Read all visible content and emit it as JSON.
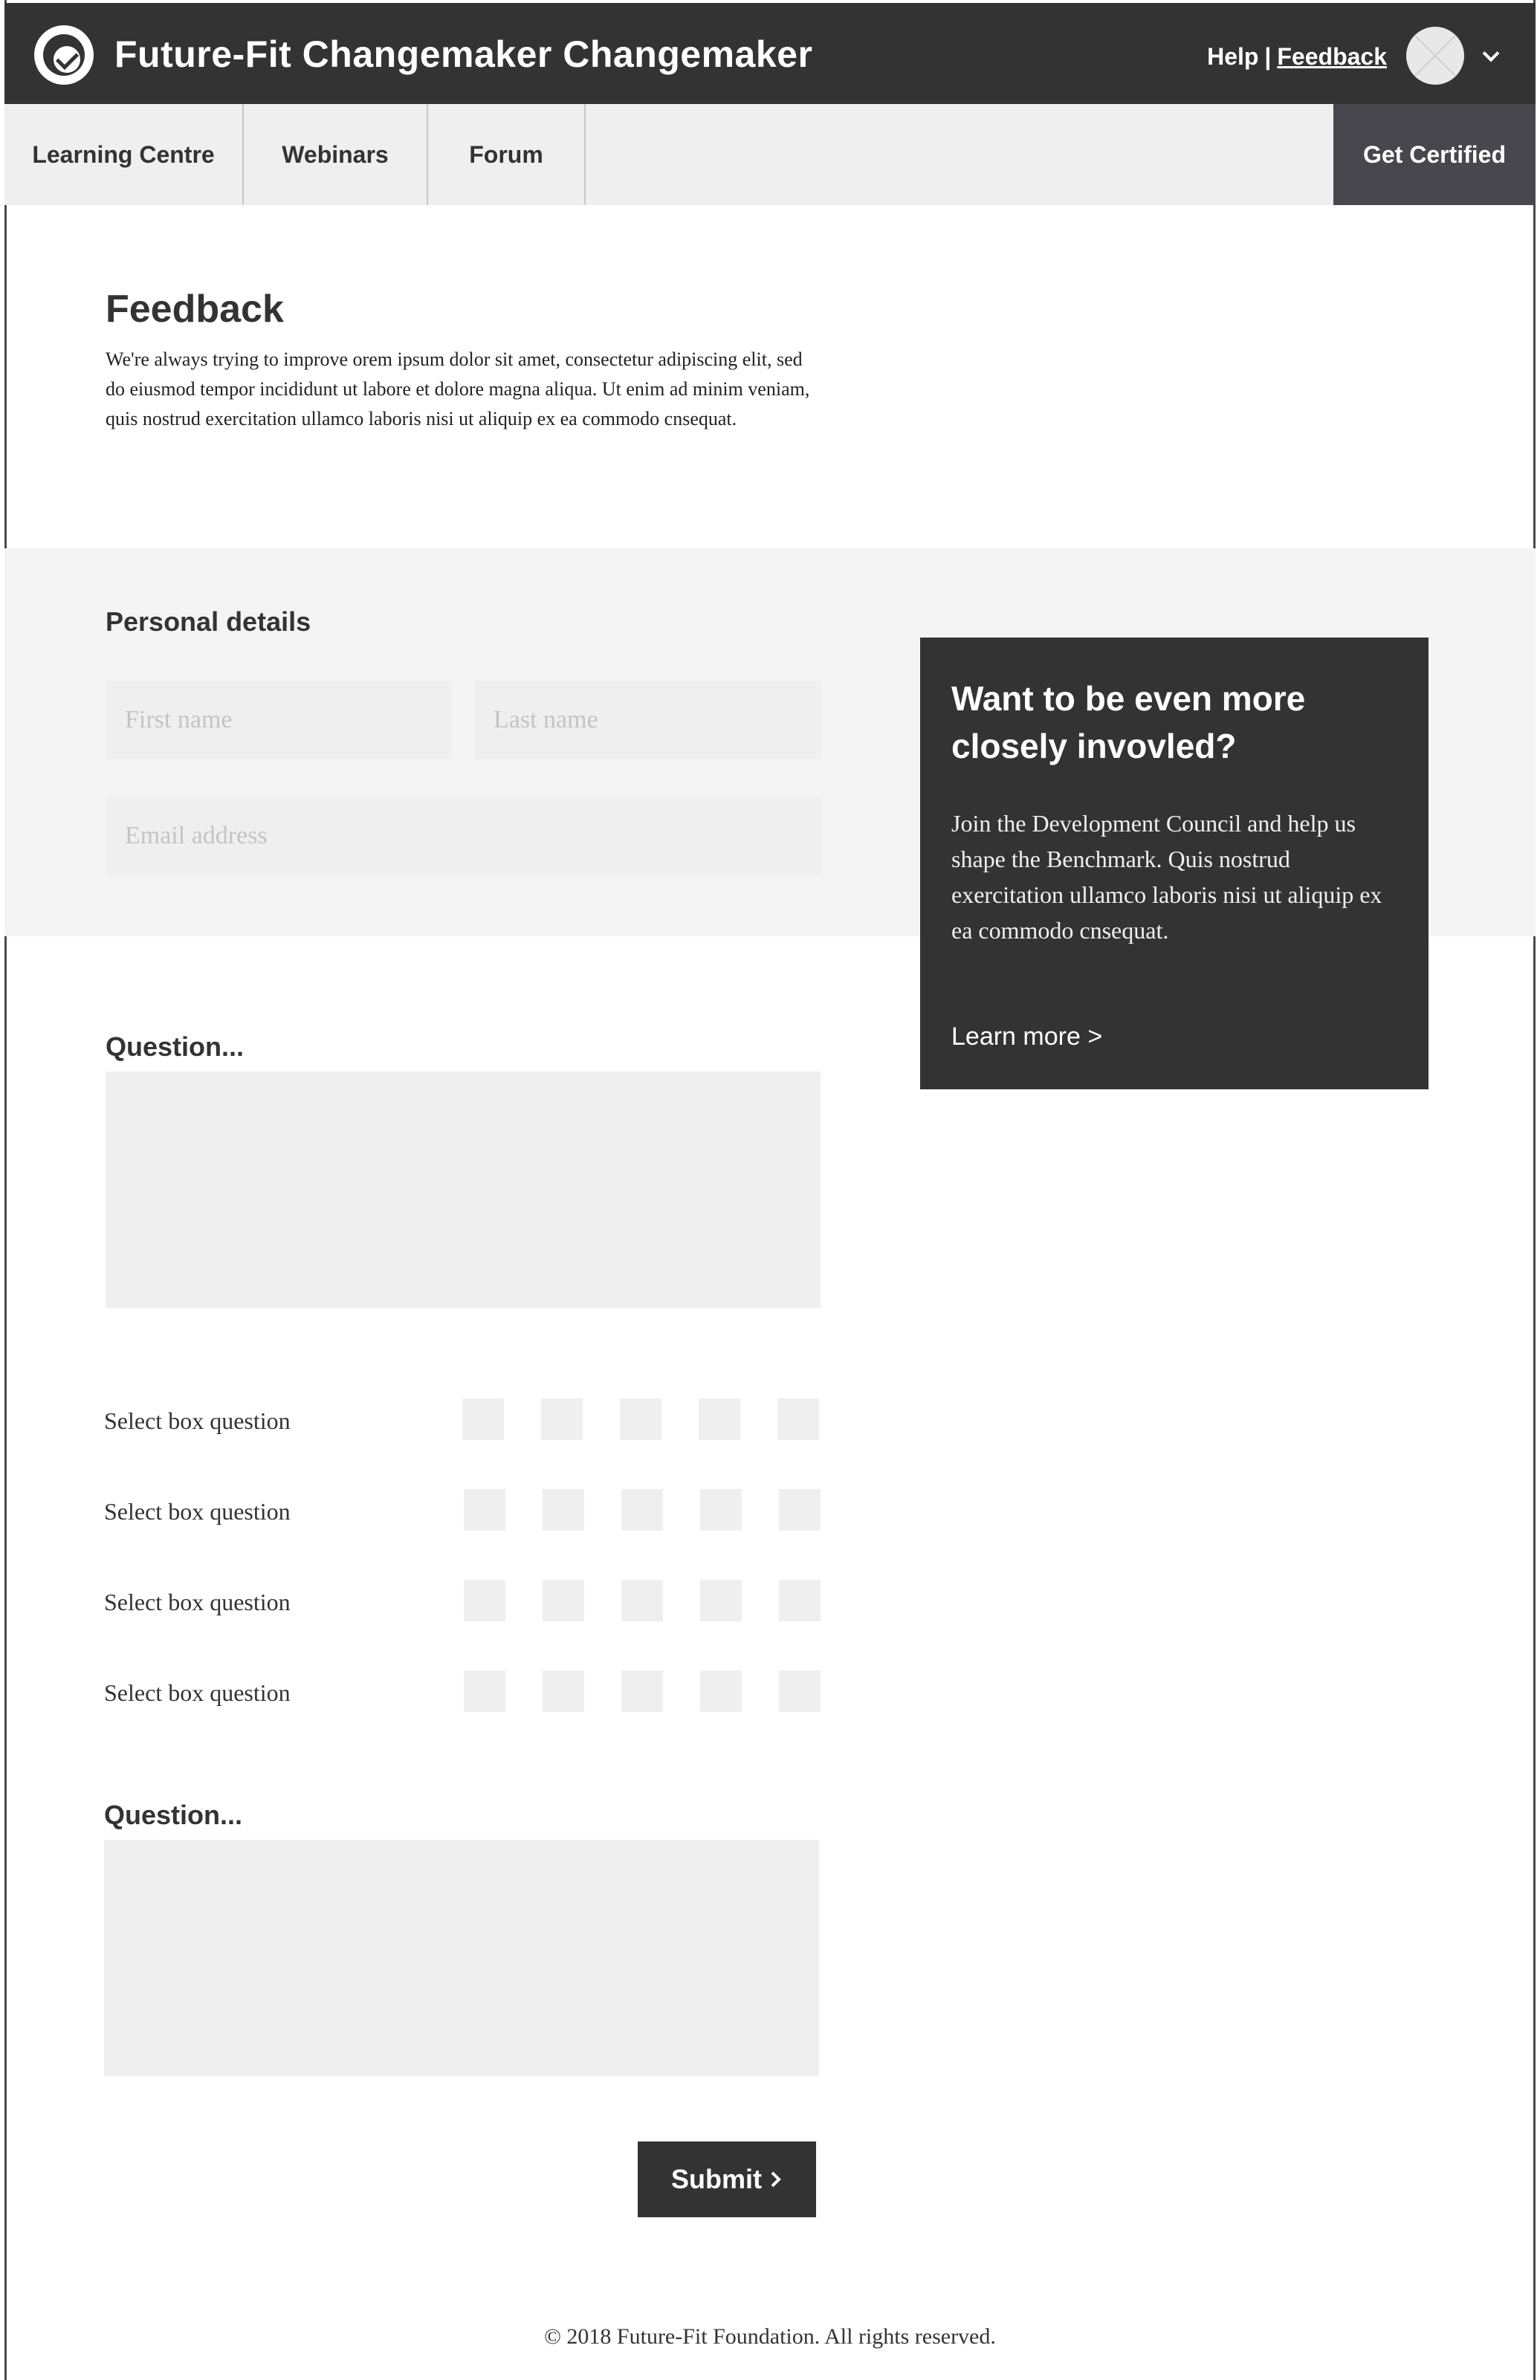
{
  "header": {
    "brand": "Future-Fit Changemaker Changemaker",
    "help_label": "Help",
    "separator": "|",
    "feedback_label": "Feedback",
    "logo_icon": "future-fit-logo-icon",
    "avatar_icon": "avatar-placeholder-icon",
    "menu_icon": "chevron-down-icon"
  },
  "nav": {
    "items": [
      {
        "label": "Learning Centre"
      },
      {
        "label": "Webinars"
      },
      {
        "label": "Forum"
      }
    ],
    "cta_label": "Get Certified"
  },
  "intro": {
    "title": "Feedback",
    "body": "We're always trying to improve orem ipsum dolor sit amet, consectetur adipiscing elit, sed do eiusmod tempor incididunt ut labore et dolore magna aliqua. Ut enim ad minim veniam, quis nostrud exercitation ullamco laboris nisi ut aliquip ex ea commodo cnsequat."
  },
  "personal_details": {
    "title": "Personal details",
    "first_name_placeholder": "First name",
    "last_name_placeholder": "Last name",
    "email_placeholder": "Email address"
  },
  "promo": {
    "title": "Want to be even more closely invovled?",
    "body": "Join the Development Council and help us shape the Benchmark. Quis nostrud exercitation ullamco laboris nisi ut aliquip ex ea commodo cnsequat.",
    "link_label": "Learn more >"
  },
  "questions": {
    "first_label": "Question...",
    "second_label": "Question...",
    "select_rows": [
      {
        "label": "Select box question"
      },
      {
        "label": "Select box question"
      },
      {
        "label": "Select box question"
      },
      {
        "label": "Select box question"
      }
    ]
  },
  "submit": {
    "label": "Submit",
    "icon": "chevron-right-icon"
  },
  "footer": {
    "text": "© 2018 Future-Fit Foundation. All rights reserved."
  },
  "colors": {
    "header_bg": "#333333",
    "nav_bg": "#efefef",
    "cta_bg": "#48474d",
    "band_bg": "#f4f4f4",
    "field_bg": "#efefef",
    "promo_bg": "#333333"
  }
}
